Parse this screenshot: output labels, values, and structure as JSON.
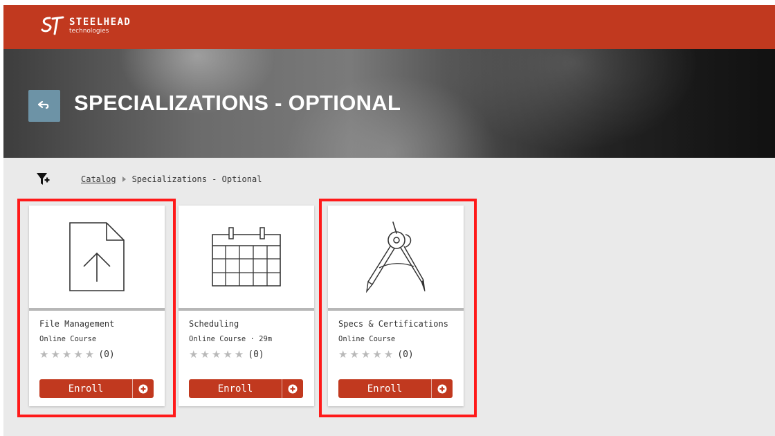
{
  "brand": {
    "name": "STEELHEAD",
    "sub": "technologies"
  },
  "header": {
    "title": "SPECIALIZATIONS - OPTIONAL",
    "back_icon": "back-arrow-icon"
  },
  "breadcrumb": {
    "root": "Catalog",
    "current": "Specializations - Optional"
  },
  "theme": {
    "accent": "#c1391f",
    "back_button": "#6d93a6",
    "highlight": "#ff1a1a"
  },
  "cards": [
    {
      "title": "File Management",
      "meta": "Online Course",
      "stars": "★★★★★",
      "rating": "(0)",
      "enroll_label": "Enroll",
      "icon": "file-upload-icon"
    },
    {
      "title": "Scheduling",
      "meta": "Online Course · 29m",
      "stars": "★★★★★",
      "rating": "(0)",
      "enroll_label": "Enroll",
      "icon": "calendar-icon"
    },
    {
      "title": "Specs & Certifications",
      "meta": "Online Course",
      "stars": "★★★★★",
      "rating": "(0)",
      "enroll_label": "Enroll",
      "icon": "drafting-compass-icon"
    }
  ]
}
